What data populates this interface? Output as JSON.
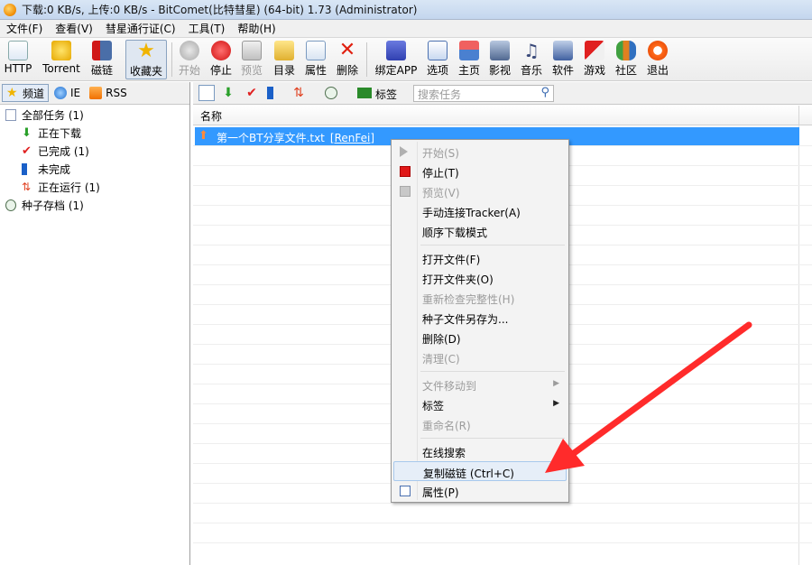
{
  "window": {
    "title": "下载:0 KB/s, 上传:0 KB/s - BitComet(比特彗星) (64-bit) 1.73 (Administrator)"
  },
  "menubar": [
    "文件(F)",
    "查看(V)",
    "彗星通行证(C)",
    "工具(T)",
    "帮助(H)"
  ],
  "toolbar": {
    "http": "HTTP",
    "torrent": "Torrent",
    "magnet": "磁链",
    "favorites": "收藏夹",
    "start": "开始",
    "stop": "停止",
    "preview": "预览",
    "folder": "目录",
    "properties": "属性",
    "delete": "删除",
    "bind_app": "绑定APP",
    "options": "选项",
    "home": "主页",
    "video": "影视",
    "music": "音乐",
    "software": "软件",
    "games": "游戏",
    "community": "社区",
    "exit": "退出"
  },
  "left_tabs": [
    "频道",
    "IE",
    "RSS"
  ],
  "tree": {
    "all_tasks": "全部任务 (1)",
    "downloading": "正在下载",
    "completed": "已完成 (1)",
    "incomplete": "未完成",
    "running": "正在运行 (1)",
    "torrent_archive": "种子存档 (1)"
  },
  "right_toolbar": {
    "tags_label": "标签",
    "search_placeholder": "搜索任务"
  },
  "list": {
    "column_name": "名称",
    "rows": [
      {
        "name": "第一个BT分享文件.txt",
        "tag": "[RenFei]"
      }
    ]
  },
  "context_menu": {
    "start": "开始(S)",
    "stop": "停止(T)",
    "preview": "预览(V)",
    "manual_tracker": "手动连接Tracker(A)",
    "sequential": "顺序下载模式",
    "open_file": "打开文件(F)",
    "open_folder": "打开文件夹(O)",
    "recheck": "重新检查完整性(H)",
    "save_torrent": "种子文件另存为...",
    "delete": "删除(D)",
    "clean": "清理(C)",
    "move_file": "文件移动到",
    "tags": "标签",
    "rename": "重命名(R)",
    "online_search": "在线搜索",
    "copy_magnet": "复制磁链 (Ctrl+C)",
    "properties": "属性(P)"
  },
  "colors": {
    "selection": "#3399ff",
    "annotation_arrow": "#ff2b2b"
  }
}
